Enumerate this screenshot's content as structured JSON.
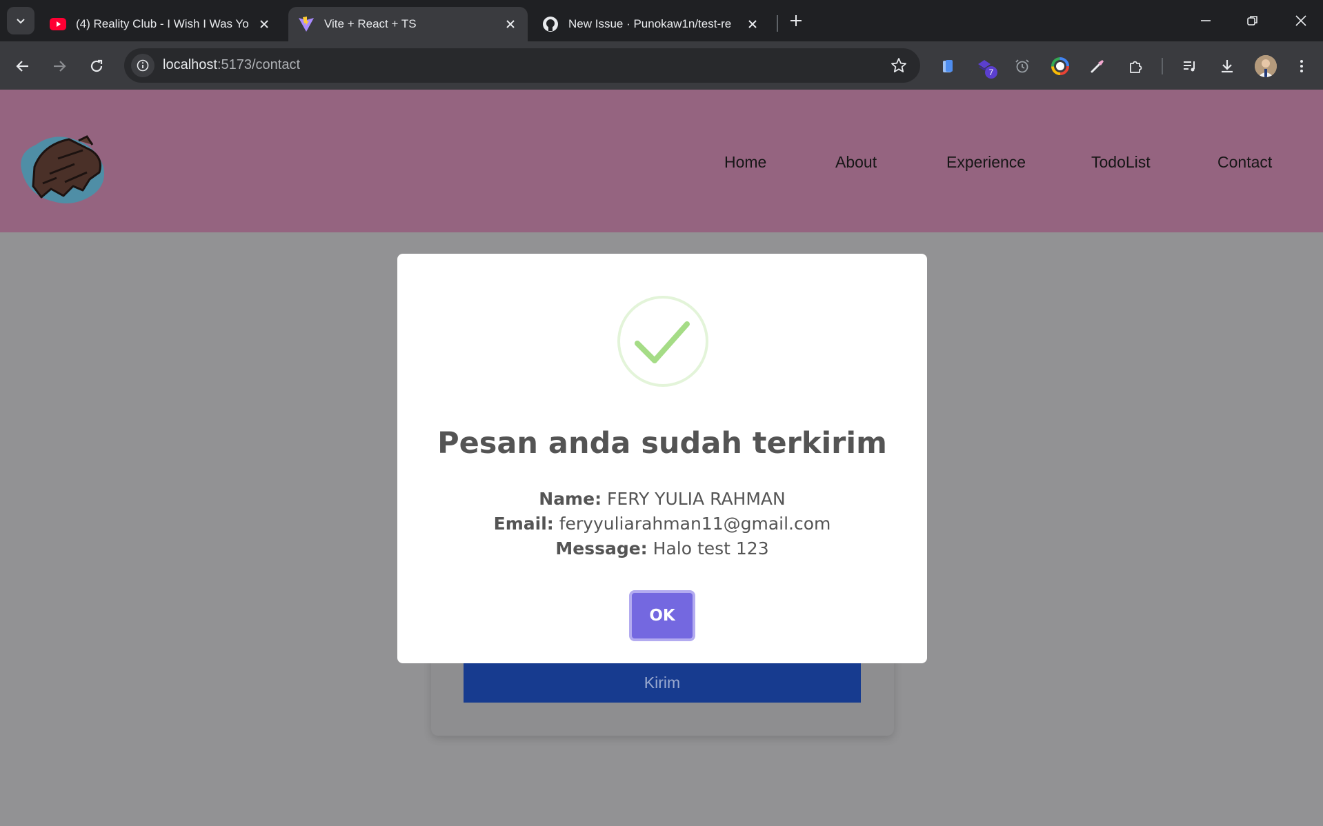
{
  "browser": {
    "tabs": [
      {
        "title": "(4) Reality Club - I Wish I Was Yo",
        "favicon": "youtube-icon",
        "active": false
      },
      {
        "title": "Vite + React + TS",
        "favicon": "vite-icon",
        "active": true
      },
      {
        "title": "New Issue · Punokaw1n/test-re",
        "favicon": "github-icon",
        "active": false
      }
    ],
    "url": {
      "host": "localhost",
      "path": ":5173/contact"
    },
    "extension_badge": "7"
  },
  "header": {
    "logo": "animal-logo",
    "nav": [
      "Home",
      "About",
      "Experience",
      "TodoList",
      "Contact"
    ]
  },
  "form": {
    "submit_label": "Kirim"
  },
  "modal": {
    "icon": "success-check-icon",
    "title": "Pesan anda sudah terkirim",
    "fields": [
      {
        "label": "Name:",
        "value": "FERY YULIA RAHMAN"
      },
      {
        "label": "Email:",
        "value": "feryyuliarahman11@gmail.com"
      },
      {
        "label": "Message:",
        "value": "Halo test 123"
      }
    ],
    "confirm_label": "OK"
  },
  "colors": {
    "header_bg": "#956480",
    "overlay_bg": "#929294",
    "confirm_button": "#7468e0",
    "submit_button": "#173b8f",
    "success_green": "#a5dc86"
  }
}
